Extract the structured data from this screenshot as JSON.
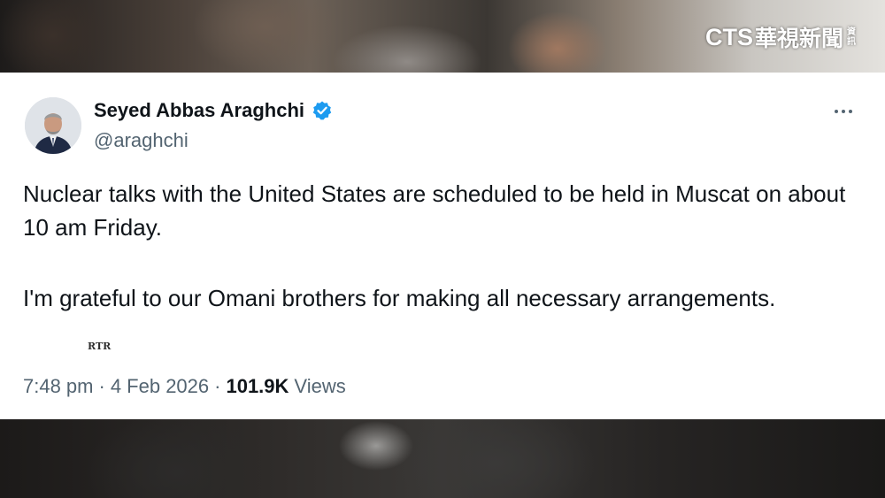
{
  "broadcaster": {
    "logo_latin": "CTS",
    "logo_cjk": "華視新聞",
    "logo_small_top": "資",
    "logo_small_bottom": "訊"
  },
  "tweet": {
    "author_name": "Seyed Abbas Araghchi",
    "handle": "@araghchi",
    "verified": true,
    "paragraph_1": "Nuclear talks with the United States are scheduled to be held in Muscat on about 10 am Friday.",
    "paragraph_2": "I'm grateful to our Omani brothers for making all necessary arrangements.",
    "time": "7:48 pm",
    "separator": "·",
    "date": "4 Feb 2026",
    "views_count": "101.9K",
    "views_label": "Views"
  },
  "overlay": {
    "watermark": "RTR"
  },
  "colors": {
    "verified_badge": "#1d9bf0",
    "text_primary": "#0f1419",
    "text_secondary": "#536471"
  },
  "icons": {
    "verified": "verified-badge-icon",
    "more": "more-options-icon"
  }
}
